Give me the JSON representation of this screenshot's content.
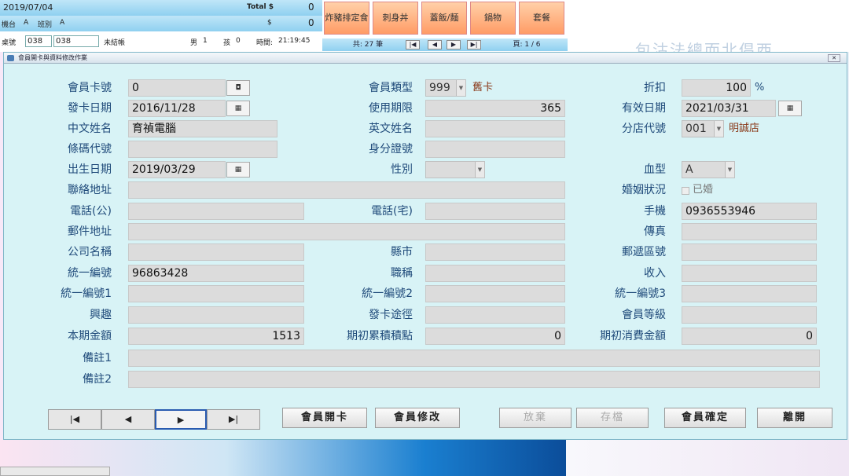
{
  "pos": {
    "date": "2019/07/04",
    "total_label": "Total $",
    "total_value": "0",
    "machine_label": "機台",
    "machine_value": "A",
    "shift_label": "班別",
    "shift_value": "A",
    "dollar_label": "$",
    "dollar_value": "0",
    "table_label": "桌號",
    "table_input1": "038",
    "table_input2": "038",
    "status": "未結帳",
    "male_label": "男",
    "male_count": "1",
    "child_label": "孩",
    "child_count": "0",
    "time_label": "時間:",
    "time_value": "21:19:45",
    "categories": [
      "炸豬排定食",
      "刺身丼",
      "蓋飯/麵",
      "鍋物",
      "套餐"
    ],
    "count_text": "共: 27 筆",
    "page_text": "頁: 1 / 6",
    "promo_text": "包沽法總而北倡西"
  },
  "dialog": {
    "title": "會員開卡與資料修改作業",
    "labels": {
      "card_no": "會員卡號",
      "member_type": "會員類型",
      "discount": "折扣",
      "issue_date": "發卡日期",
      "usage_period": "使用期限",
      "expiry_date": "有效日期",
      "chinese_name": "中文姓名",
      "english_name": "英文姓名",
      "branch_code": "分店代號",
      "barcode": "條碼代號",
      "id_no": "身分證號",
      "birth_date": "出生日期",
      "gender": "性別",
      "blood_type": "血型",
      "contact_address": "聯絡地址",
      "marital_status": "婚姻狀況",
      "phone_office": "電話(公)",
      "phone_home": "電話(宅)",
      "mobile": "手機",
      "mail_address": "郵件地址",
      "fax": "傳真",
      "company_name": "公司名稱",
      "city": "縣市",
      "postal_code": "郵遞區號",
      "tax_id": "統一編號",
      "job_title": "職稱",
      "income": "收入",
      "tax_id1": "統一編號1",
      "tax_id2": "統一編號2",
      "tax_id3": "統一編號3",
      "hobby": "興趣",
      "card_channel": "發卡途徑",
      "member_level": "會員等級",
      "period_amount": "本期金額",
      "initial_points": "期初累積積點",
      "initial_spend": "期初消費金額",
      "note1": "備註1",
      "note2": "備註2"
    },
    "values": {
      "card_no": "0",
      "member_type": "999",
      "member_type_name": "舊卡",
      "discount": "100",
      "discount_unit": "%",
      "issue_date": "2016/11/28",
      "usage_period": "365",
      "expiry_date": "2021/03/31",
      "chinese_name": "育禎電腦",
      "branch_code": "001",
      "branch_name": "明誠店",
      "birth_date": "2019/03/29",
      "blood_type": "A",
      "married_label": "已婚",
      "mobile": "0936553946",
      "tax_id": "96863428",
      "period_amount": "1513",
      "initial_points": "0",
      "initial_spend": "0"
    },
    "buttons": {
      "open_card": "會員開卡",
      "modify": "會員修改",
      "discard": "放棄",
      "save": "存檔",
      "confirm": "會員確定",
      "leave": "離開"
    },
    "nav": {
      "first": "|◀",
      "prev": "◀",
      "next": "▶",
      "last": "▶|"
    },
    "cal_button": "??"
  }
}
